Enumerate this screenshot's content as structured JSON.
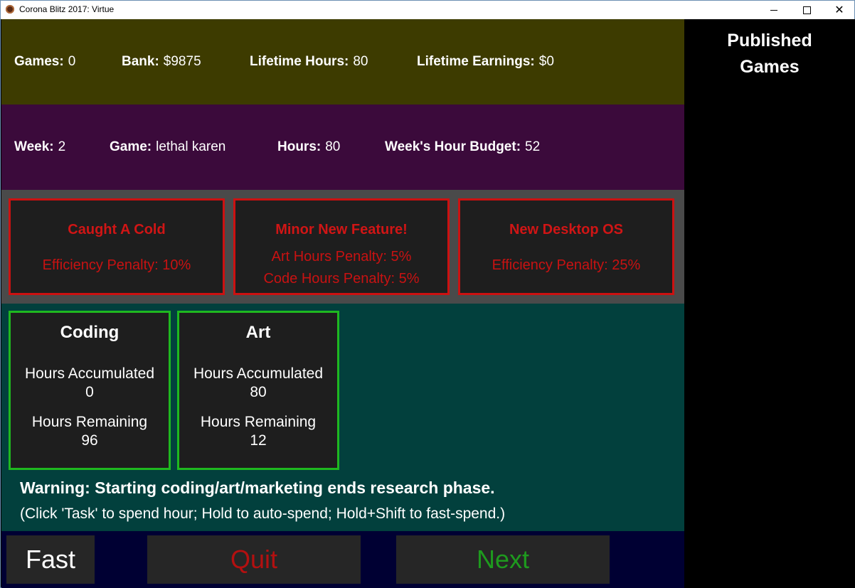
{
  "window": {
    "title": "Corona Blitz 2017: Virtue"
  },
  "stats_top": {
    "games": {
      "label": "Games:",
      "value": "0"
    },
    "bank": {
      "label": "Bank:",
      "value": "$9875"
    },
    "lifetime_hours": {
      "label": "Lifetime Hours:",
      "value": "80"
    },
    "lifetime_earnings": {
      "label": "Lifetime Earnings:",
      "value": "$0"
    }
  },
  "stats_week": {
    "week": {
      "label": "Week:",
      "value": "2"
    },
    "game": {
      "label": "Game:",
      "value": "lethal karen"
    },
    "hours": {
      "label": "Hours:",
      "value": "80"
    },
    "budget": {
      "label": "Week's Hour Budget:",
      "value": "52"
    }
  },
  "events": [
    {
      "title": "Caught A Cold",
      "lines": [
        "Efficiency Penalty: 10%"
      ]
    },
    {
      "title": "Minor New Feature!",
      "lines": [
        "Art Hours Penalty: 5%",
        "Code Hours Penalty: 5%"
      ]
    },
    {
      "title": "New Desktop OS",
      "lines": [
        "Efficiency Penalty: 25%"
      ]
    }
  ],
  "tasks": [
    {
      "title": "Coding",
      "accum_label": "Hours Accumulated",
      "accum_value": "0",
      "remain_label": "Hours Remaining",
      "remain_value": "96"
    },
    {
      "title": "Art",
      "accum_label": "Hours Accumulated",
      "accum_value": "80",
      "remain_label": "Hours Remaining",
      "remain_value": "12"
    }
  ],
  "warning": "Warning: Starting coding/art/marketing ends research phase.",
  "hint": "(Click 'Task' to spend hour; Hold to auto-spend; Hold+Shift to fast-spend.)",
  "buttons": {
    "fast": "Fast",
    "quit": "Quit",
    "next": "Next"
  },
  "sidebar": {
    "title": "Published\nGames"
  },
  "colors": {
    "stats_top_bg": "#3d3b00",
    "stats_week_bg": "#3b0a3b",
    "events_bg": "#4a4a4a",
    "tasks_bg": "#02403d",
    "event_accent": "#cc1111",
    "task_accent": "#1fb81f",
    "quit_text": "#b31010",
    "next_text": "#1e9a1e"
  }
}
